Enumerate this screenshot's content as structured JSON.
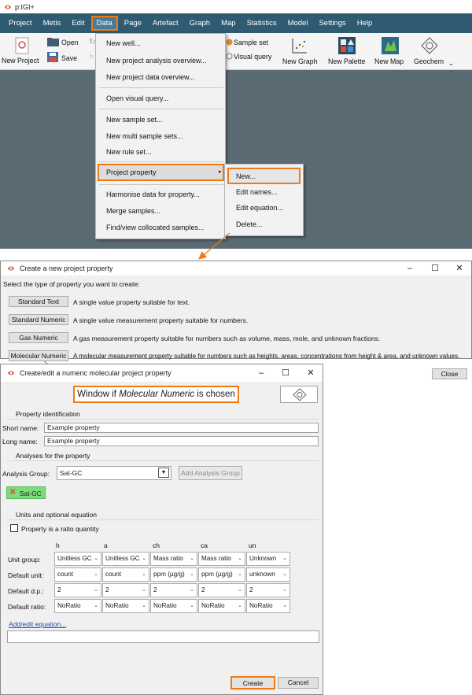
{
  "app": {
    "title": "p:IGI+",
    "menu": [
      "Project",
      "Metis",
      "Edit",
      "Data",
      "Page",
      "Artefact",
      "Graph",
      "Map",
      "Statistics",
      "Model",
      "Settings",
      "Help"
    ],
    "toolbar": {
      "new_project": "New Project",
      "open": "Open",
      "save": "Save",
      "sample_set": "Sample set",
      "visual_query": "Visual query",
      "new_graph": "New Graph",
      "new_palette": "New Palette",
      "new_map": "New Map",
      "geochem": "Geochem"
    }
  },
  "data_menu": {
    "items": [
      "New well...",
      "New project analysis overview...",
      "New project data overview...",
      "Open visual query...",
      "New sample set...",
      "New multi sample sets...",
      "New rule set...",
      "Project property",
      "Harmonise data for property...",
      "Merge samples...",
      "Find/view collocated samples..."
    ],
    "submenu": [
      "New...",
      "Edit names...",
      "Edit equation...",
      "Delete..."
    ]
  },
  "dialog1": {
    "title": "Create a new project property",
    "prompt": "Select the type of property you want to create:",
    "types": [
      {
        "label": "Standard Text",
        "desc": "A single value property suitable for text."
      },
      {
        "label": "Standard Numeric",
        "desc": "A single value measurement property suitable for numbers."
      },
      {
        "label": "Gas Numeric",
        "desc": "A gas measurement property suitable for numbers such as volume, mass, mole, and unknown fractions."
      },
      {
        "label": "Molecular Numeric",
        "desc": "A molecular measurement property suitable for numbers such as heights, areas, concentrations from height & area, and unknown values."
      }
    ],
    "close": "Close",
    "window_controls": [
      "–",
      "☐",
      "✕"
    ]
  },
  "dialog2": {
    "title": "Create/edit a numeric molecular project property",
    "annotation_pre": "Window if ",
    "annotation_em": "Molecular Numeric",
    "annotation_post": " is chosen",
    "section_id": "Property identification",
    "short_name_label": "Short name:",
    "short_name_value": "Example property",
    "long_name_label": "Long name:",
    "long_name_value": "Example property",
    "section_analyses": "Analyses for the property",
    "analysis_group_label": "Analysis Group:",
    "analysis_group_value": "Sat-GC",
    "add_analysis_group": "Add Analysis Group",
    "chip": "Sat-GC",
    "section_units": "Units and optional equation",
    "ratio_checkbox": "Property is a ratio quantity",
    "columns": [
      "h",
      "a",
      "ch",
      "ca",
      "un"
    ],
    "rows": [
      {
        "label": "Unit group:",
        "values": [
          "Unitless GC",
          "Unitless GC",
          "Mass ratio",
          "Mass ratio",
          "Unknown"
        ]
      },
      {
        "label": "Default unit:",
        "values": [
          "count",
          "count",
          "ppm (µg/g)",
          "ppm (µg/g)",
          "unknown"
        ]
      },
      {
        "label": "Default d.p.:",
        "values": [
          "2",
          "2",
          "2",
          "2",
          "2"
        ]
      },
      {
        "label": "Default ratio:",
        "values": [
          "NoRatio",
          "NoRatio",
          "NoRatio",
          "NoRatio",
          "NoRatio"
        ]
      }
    ],
    "add_edit_equation": "Add/edit equation...",
    "create": "Create",
    "cancel": "Cancel",
    "window_controls": [
      "–",
      "☐",
      "✕"
    ]
  },
  "colors": {
    "menubar": "#2e5a72",
    "workspace": "#5b6b74",
    "highlight": "#f07b14",
    "chip_bg": "#7ddb7d",
    "chip_icon": "#e0452b"
  }
}
